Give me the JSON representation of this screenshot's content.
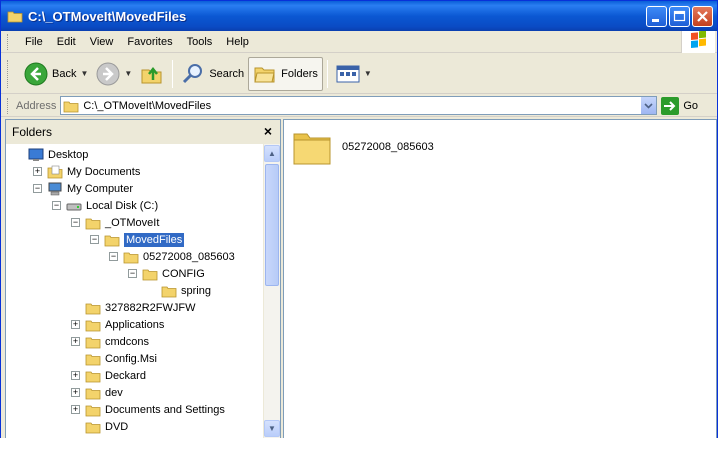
{
  "window": {
    "title": "C:\\_OTMoveIt\\MovedFiles"
  },
  "menu": [
    "File",
    "Edit",
    "View",
    "Favorites",
    "Tools",
    "Help"
  ],
  "toolbar": {
    "back": "Back",
    "search": "Search",
    "folders": "Folders"
  },
  "address": {
    "label": "Address",
    "value": "C:\\_OTMoveIt\\MovedFiles",
    "go": "Go"
  },
  "folders_pane": {
    "title": "Folders",
    "close": "×",
    "tree": [
      {
        "label": "Desktop",
        "level": 0,
        "expander": "",
        "icon": "desktop-icon"
      },
      {
        "label": "My Documents",
        "level": 1,
        "expander": "+",
        "icon": "my-documents-icon"
      },
      {
        "label": "My Computer",
        "level": 1,
        "expander": "-",
        "icon": "my-computer-icon"
      },
      {
        "label": "Local Disk (C:)",
        "level": 2,
        "expander": "-",
        "icon": "disk-icon"
      },
      {
        "label": "_OTMoveIt",
        "level": 3,
        "expander": "-",
        "icon": "folder-icon"
      },
      {
        "label": "MovedFiles",
        "level": 4,
        "expander": "-",
        "icon": "folder-icon",
        "selected": true
      },
      {
        "label": "05272008_085603",
        "level": 5,
        "expander": "-",
        "icon": "folder-icon"
      },
      {
        "label": "CONFIG",
        "level": 6,
        "expander": "-",
        "icon": "folder-icon"
      },
      {
        "label": "spring",
        "level": 7,
        "expander": "",
        "icon": "folder-icon"
      },
      {
        "label": "327882R2FWJFW",
        "level": 3,
        "expander": "",
        "icon": "folder-icon"
      },
      {
        "label": "Applications",
        "level": 3,
        "expander": "+",
        "icon": "folder-icon"
      },
      {
        "label": "cmdcons",
        "level": 3,
        "expander": "+",
        "icon": "folder-icon"
      },
      {
        "label": "Config.Msi",
        "level": 3,
        "expander": "",
        "icon": "folder-icon"
      },
      {
        "label": "Deckard",
        "level": 3,
        "expander": "+",
        "icon": "folder-icon"
      },
      {
        "label": "dev",
        "level": 3,
        "expander": "+",
        "icon": "folder-icon"
      },
      {
        "label": "Documents and Settings",
        "level": 3,
        "expander": "+",
        "icon": "folder-icon"
      },
      {
        "label": "DVD",
        "level": 3,
        "expander": "",
        "icon": "folder-icon"
      }
    ]
  },
  "content": {
    "items": [
      {
        "label": "05272008_085603",
        "icon": "folder-icon"
      }
    ]
  },
  "colors": {
    "titlebar": "#0a5fd8",
    "selection": "#316ac5",
    "chrome": "#ece9d8"
  }
}
